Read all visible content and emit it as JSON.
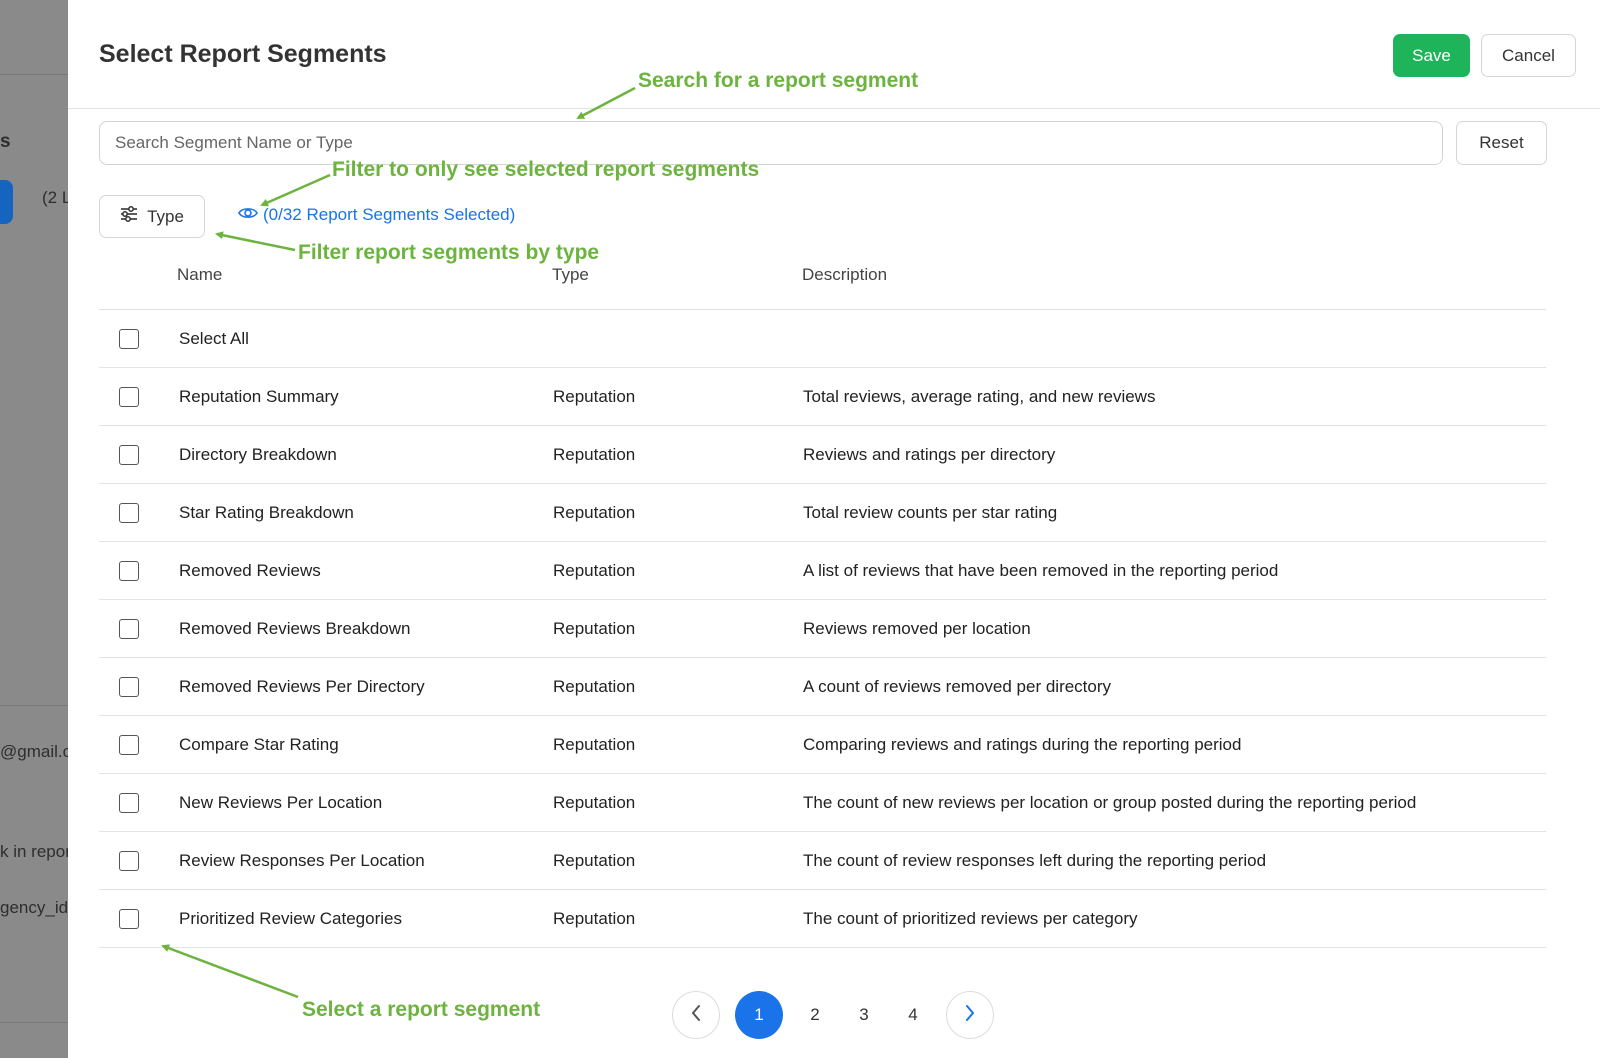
{
  "background": {
    "fragments": [
      "s",
      "(2 L",
      "@gmail.c",
      "k in repor",
      "gency_id"
    ]
  },
  "modal": {
    "title": "Select Report Segments",
    "save_label": "Save",
    "cancel_label": "Cancel",
    "search_placeholder": "Search Segment Name or Type",
    "reset_label": "Reset",
    "type_filter_label": "Type",
    "selected_toggle_label": "(0/32 Report Segments Selected)",
    "columns": {
      "name": "Name",
      "type": "Type",
      "description": "Description"
    },
    "select_all_label": "Select All",
    "rows": [
      {
        "name": "Reputation Summary",
        "type": "Reputation",
        "description": "Total reviews, average rating, and new reviews"
      },
      {
        "name": "Directory Breakdown",
        "type": "Reputation",
        "description": "Reviews and ratings per directory"
      },
      {
        "name": "Star Rating Breakdown",
        "type": "Reputation",
        "description": "Total review counts per star rating"
      },
      {
        "name": "Removed Reviews",
        "type": "Reputation",
        "description": "A list of reviews that have been removed in the reporting period"
      },
      {
        "name": "Removed Reviews Breakdown",
        "type": "Reputation",
        "description": "Reviews removed per location"
      },
      {
        "name": "Removed Reviews Per Directory",
        "type": "Reputation",
        "description": "A count of reviews removed per directory"
      },
      {
        "name": "Compare Star Rating",
        "type": "Reputation",
        "description": "Comparing reviews and ratings during the reporting period"
      },
      {
        "name": "New Reviews Per Location",
        "type": "Reputation",
        "description": "The count of new reviews per location or group posted during the reporting period"
      },
      {
        "name": "Review Responses Per Location",
        "type": "Reputation",
        "description": "The count of review responses left during the reporting period"
      },
      {
        "name": "Prioritized Review Categories",
        "type": "Reputation",
        "description": "The count of prioritized reviews per category"
      }
    ],
    "pagination": {
      "pages": [
        "1",
        "2",
        "3",
        "4"
      ],
      "current": "1"
    }
  },
  "annotations": {
    "search": "Search for a report segment",
    "filter_selected": "Filter to only see selected report segments",
    "filter_type": "Filter report segments by type",
    "select_segment": "Select a report segment"
  },
  "colors": {
    "save_green": "#1fb35a",
    "link_blue": "#1a73e8",
    "annotation_green": "#6db33f",
    "overlay_gray": "#8a8a8a"
  }
}
